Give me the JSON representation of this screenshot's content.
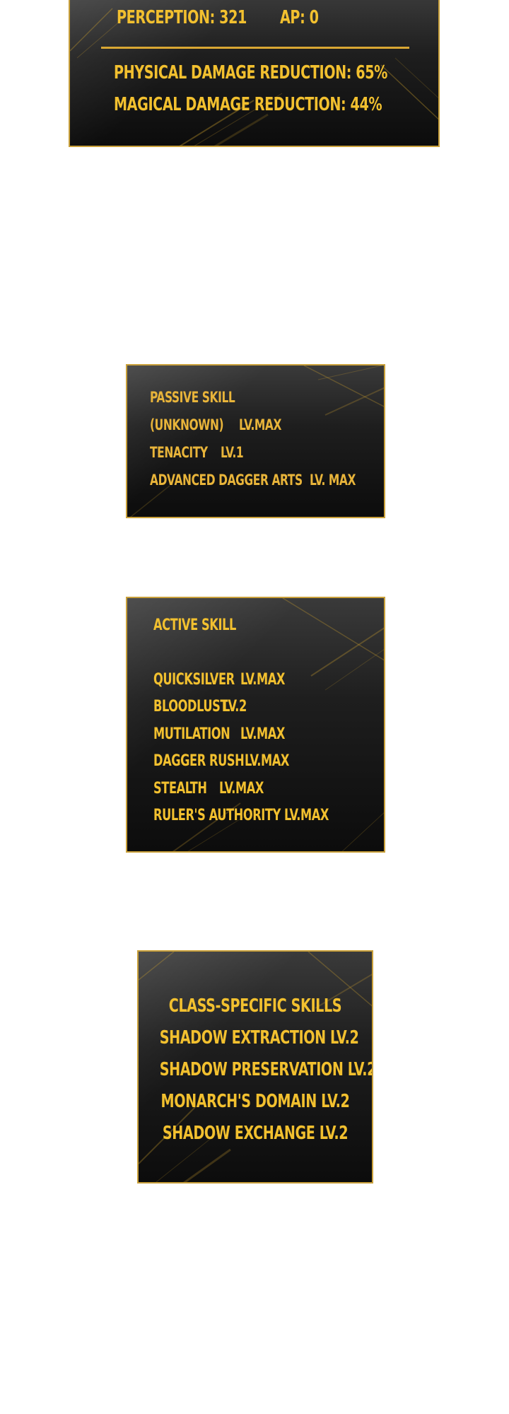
{
  "stats": {
    "perception": "PERCEPTION: 321",
    "ap": "AP: 0",
    "physical": "PHYSICAL DAMAGE REDUCTION: 65%",
    "magical": "MAGICAL DAMAGE REDUCTION: 44%"
  },
  "passive": {
    "title": "PASSIVE SKILL",
    "items": [
      {
        "name": "(UNKNOWN)",
        "level": "LV.MAX"
      },
      {
        "name": "TENACITY",
        "level": "LV.1"
      },
      {
        "name": "ADVANCED DAGGER ARTS",
        "level": "LV. MAX"
      }
    ]
  },
  "active": {
    "title": "ACTIVE SKILL",
    "items": [
      {
        "name": "QUICKSILVER",
        "level": "LV.MAX"
      },
      {
        "name": "BLOODLUST",
        "level": "LV.2"
      },
      {
        "name": "MUTILATION",
        "level": "LV.MAX"
      },
      {
        "name": "DAGGER RUSH",
        "level": "LV.MAX"
      },
      {
        "name": "STEALTH",
        "level": "LV.MAX"
      },
      {
        "name": "RULER'S AUTHORITY",
        "level": "LV.MAX"
      }
    ]
  },
  "class_skills": {
    "title": "CLASS-SPECIFIC SKILLS",
    "items": [
      "SHADOW EXTRACTION  LV.2",
      "SHADOW PRESERVATION  LV.2",
      "MONARCH'S DOMAIN  LV.2",
      "SHADOW EXCHANGE LV.2"
    ]
  },
  "colors": {
    "text_gold": "#f2c02f",
    "border_gold": "#c9a03a",
    "panel_dark": "#0c0c0c"
  }
}
